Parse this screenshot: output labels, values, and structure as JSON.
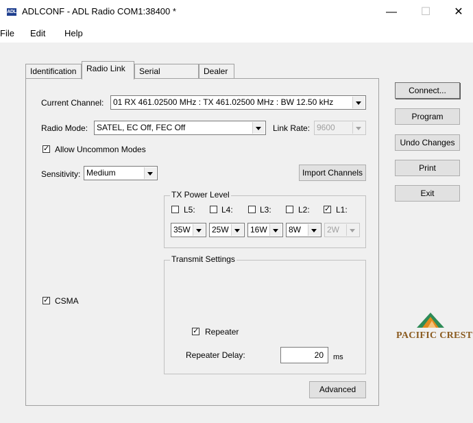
{
  "window": {
    "title": "ADLCONF - ADL Radio COM1:38400 *",
    "icon_text": "ADL",
    "minimize": "—",
    "maximize": "☐",
    "close": "✕"
  },
  "menu": [
    "File",
    "Edit",
    "Help"
  ],
  "tabs": [
    "Identification",
    "Radio Link",
    "Serial Interface",
    "Dealer"
  ],
  "active_tab": "Radio Link",
  "radio_link": {
    "current_channel_label": "Current Channel:",
    "current_channel_value": "01  RX 461.02500 MHz : TX 461.02500 MHz : BW 12.50 kHz",
    "radio_mode_label": "Radio Mode:",
    "radio_mode_value": "SATEL, EC Off, FEC Off",
    "link_rate_label": "Link Rate:",
    "link_rate_value": "9600",
    "allow_uncommon_label": "Allow Uncommon Modes",
    "allow_uncommon_checked": true,
    "sensitivity_label": "Sensitivity:",
    "sensitivity_value": "Medium",
    "import_channels_label": "Import Channels",
    "tx_power": {
      "title": "TX Power Level",
      "levels": [
        {
          "label": "L5:",
          "checked": false,
          "value": "35W",
          "enabled": true
        },
        {
          "label": "L4:",
          "checked": false,
          "value": "25W",
          "enabled": true
        },
        {
          "label": "L3:",
          "checked": false,
          "value": "16W",
          "enabled": true
        },
        {
          "label": "L2:",
          "checked": false,
          "value": "8W",
          "enabled": true
        },
        {
          "label": "L1:",
          "checked": true,
          "value": "2W",
          "enabled": false
        }
      ]
    },
    "transmit_settings": {
      "title": "Transmit Settings",
      "repeater_label": "Repeater",
      "repeater_checked": true,
      "repeater_delay_label": "Repeater Delay:",
      "repeater_delay_value": "20",
      "repeater_delay_unit": "ms"
    },
    "csma_label": "CSMA",
    "csma_checked": true,
    "advanced_label": "Advanced"
  },
  "side_buttons": [
    "Connect...",
    "Program",
    "Undo Changes",
    "Print",
    "Exit"
  ],
  "logo": {
    "text": "PACIFIC CREST"
  },
  "colors": {
    "logo_orange": "#e08a1e",
    "logo_green": "#2e8b57",
    "logo_text": "#8a5a1e"
  }
}
